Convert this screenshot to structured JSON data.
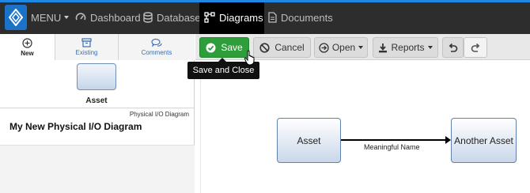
{
  "topbar": {
    "menu_label": "MENU",
    "items": [
      {
        "label": "Dashboard",
        "icon": "speedometer-icon"
      },
      {
        "label": "Database",
        "icon": "database-icon"
      },
      {
        "label": "Diagrams",
        "icon": "diagram-icon",
        "active": true
      },
      {
        "label": "Documents",
        "icon": "document-icon"
      }
    ],
    "colors": {
      "background": "#2d2d2d",
      "accent": "#1e88e5",
      "active": "#000000"
    }
  },
  "left_panel": {
    "tabs": [
      {
        "label": "New",
        "icon": "plus-circle-icon",
        "active": true
      },
      {
        "label": "Existing",
        "icon": "archive-icon"
      },
      {
        "label": "Comments",
        "icon": "comments-icon"
      }
    ],
    "palette_item": "Asset",
    "diagram_type": "Physical I/O Diagram",
    "diagram_name": "My New Physical I/O Diagram"
  },
  "toolbar": {
    "save_label": "Save",
    "cancel_label": "Cancel",
    "open_label": "Open",
    "reports_label": "Reports",
    "save_color": "#2e9e3b"
  },
  "tooltip": {
    "text": "Save and Close"
  },
  "diagram": {
    "nodes": [
      {
        "label": "Asset"
      },
      {
        "label": "Another Asset"
      }
    ],
    "edge_label": "Meaningful Name"
  }
}
